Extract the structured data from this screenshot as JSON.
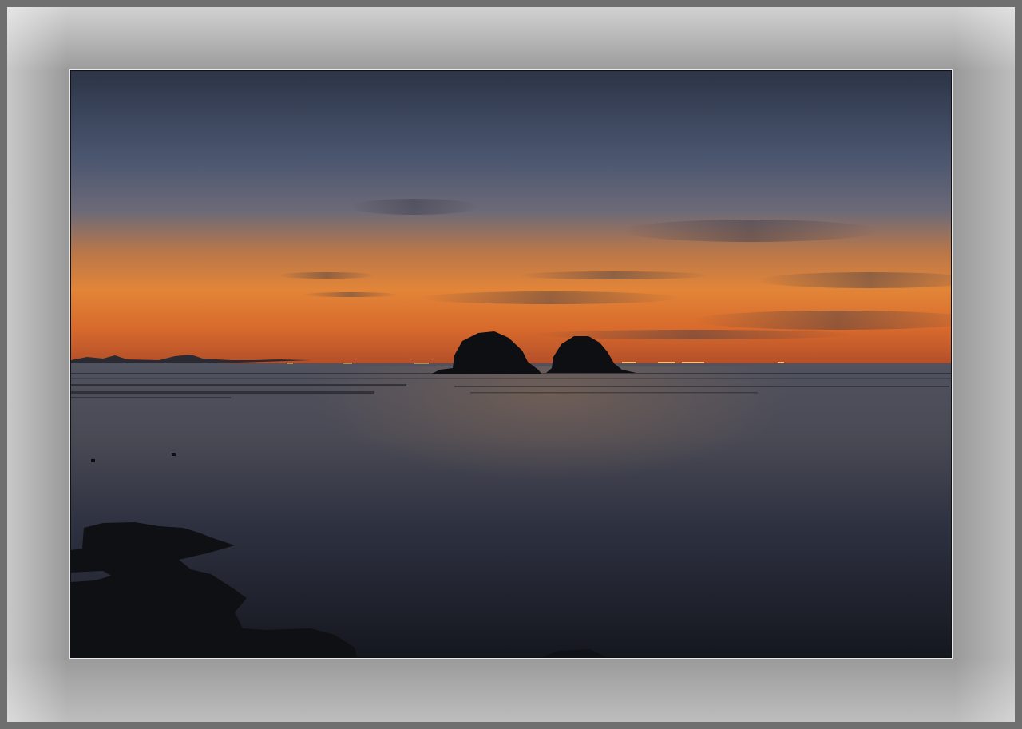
{
  "frame": {
    "colors": {
      "outer": "#6f6f6f",
      "mat": "#9a9a9a",
      "photo_border": "#e8e8e8"
    }
  },
  "photo": {
    "subject": "sunset-seascape",
    "colors": {
      "sky_top": "#2b3445",
      "sky_mid": "#5c6a86",
      "sky_glow": "#e98a3a",
      "horizon": "#c8562a",
      "water_top": "#4a4e5e",
      "water_bottom": "#141620",
      "silhouette": "#0d0f12"
    }
  }
}
